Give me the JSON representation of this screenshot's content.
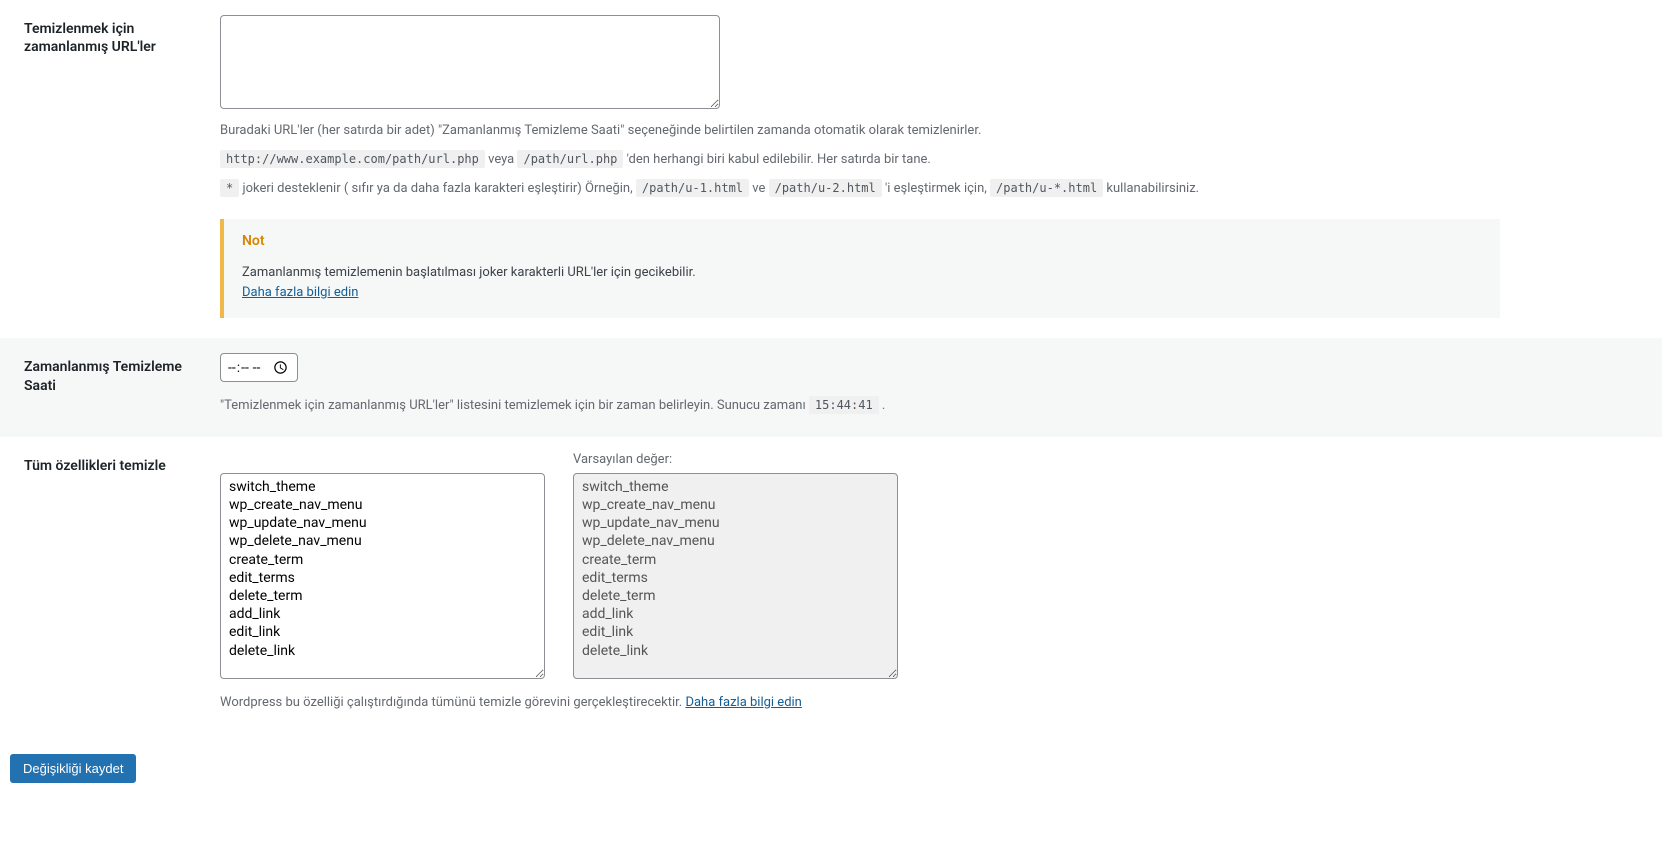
{
  "row1": {
    "label": "Temizlenmek için zamanlanmış URL'ler",
    "textarea_value": "",
    "desc1": "Buradaki URL'ler (her satırda bir adet) \"Zamanlanmış Temizleme Saati\" seçeneğinde belirtilen zamanda otomatik olarak temizlenirler.",
    "code1": "http://www.example.com/path/url.php",
    "mid1": " veya ",
    "code2": "/path/url.php",
    "tail1": " 'den herhangi biri kabul edilebilir. Her satırda bir tane.",
    "code_wild": "*",
    "wild_text": " jokeri desteklenir ( sıfır ya da daha fazla karakteri eşleştirir) Örneğin, ",
    "code3": "/path/u-1.html",
    "mid2": " ve ",
    "code4": "/path/u-2.html",
    "mid3": " 'i eşleştirmek için, ",
    "code5": "/path/u-*.html",
    "tail2": " kullanabilirsiniz.",
    "note_title": "Not",
    "note_text": "Zamanlanmış temizlemenin başlatılması joker karakterli URL'ler için gecikebilir.",
    "note_link": "Daha fazla bilgi edin"
  },
  "row2": {
    "label": "Zamanlanmış Temizleme Saati",
    "time_value": "--:--",
    "desc_pre": "\"Temizlenmek için zamanlanmış URL'ler\" listesini temizlemek için bir zaman belirleyin. Sunucu zamanı ",
    "server_time": "15:44:41",
    "desc_post": " ."
  },
  "row3": {
    "label": "Tüm özellikleri temizle",
    "default_label": "Varsayılan değer:",
    "current_value": "switch_theme\nwp_create_nav_menu\nwp_update_nav_menu\nwp_delete_nav_menu\ncreate_term\nedit_terms\ndelete_term\nadd_link\nedit_link\ndelete_link",
    "default_value": "switch_theme\nwp_create_nav_menu\nwp_update_nav_menu\nwp_delete_nav_menu\ncreate_term\nedit_terms\ndelete_term\nadd_link\nedit_link\ndelete_link",
    "desc": "Wordpress bu özelliği çalıştırdığında tümünü temizle görevini gerçekleştirecektir. ",
    "desc_link": "Daha fazla bilgi edin"
  },
  "submit": {
    "label": "Değişikliği kaydet"
  }
}
